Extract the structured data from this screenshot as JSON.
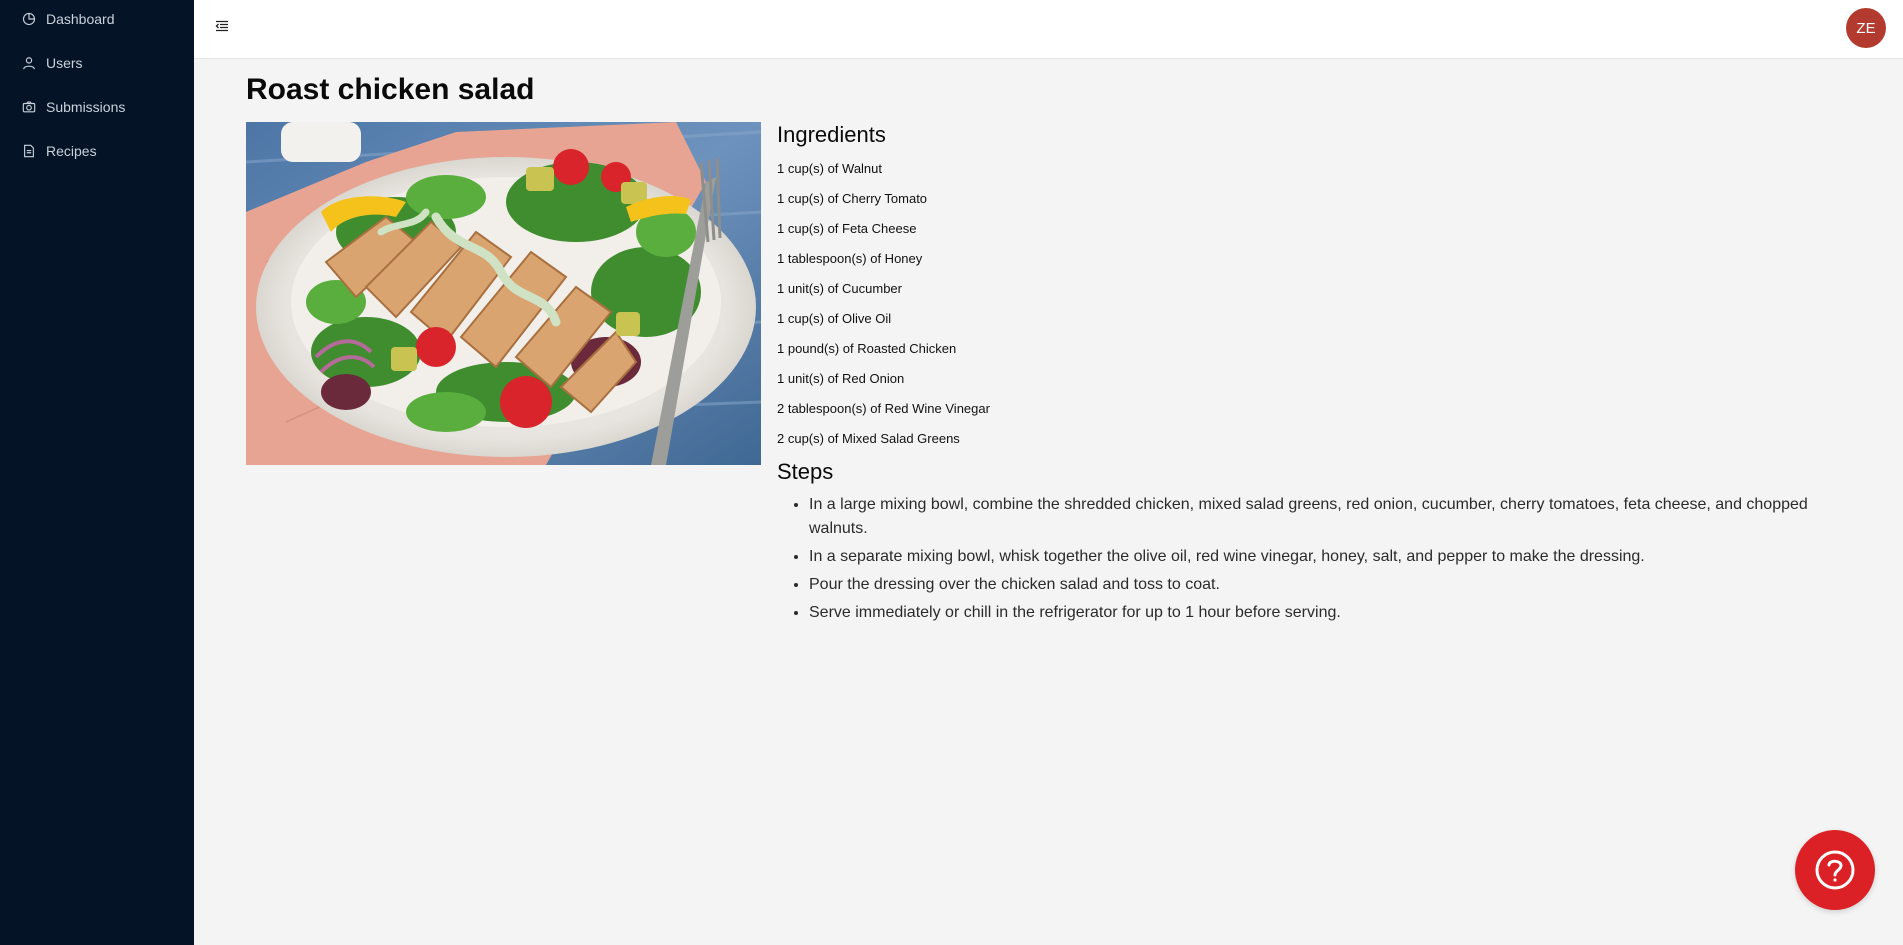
{
  "sidebar": {
    "items": [
      {
        "label": "Dashboard",
        "icon": "pie-chart-icon"
      },
      {
        "label": "Users",
        "icon": "user-icon"
      },
      {
        "label": "Submissions",
        "icon": "camera-icon"
      },
      {
        "label": "Recipes",
        "icon": "document-icon"
      }
    ]
  },
  "header": {
    "avatar_initials": "ZE"
  },
  "recipe": {
    "title": "Roast chicken salad",
    "ingredients_heading": "Ingredients",
    "ingredients": [
      "1 cup(s) of Walnut",
      "1 cup(s) of Cherry Tomato",
      "1 cup(s) of Feta Cheese",
      "1 tablespoon(s) of Honey",
      "1 unit(s) of Cucumber",
      "1 cup(s) of Olive Oil",
      "1 pound(s) of Roasted Chicken",
      "1 unit(s) of Red Onion",
      "2 tablespoon(s) of Red Wine Vinegar",
      "2 cup(s) of Mixed Salad Greens"
    ],
    "steps_heading": "Steps",
    "steps": [
      "In a large mixing bowl, combine the shredded chicken, mixed salad greens, red onion, cucumber, cherry tomatoes, feta cheese, and chopped walnuts.",
      "In a separate mixing bowl, whisk together the olive oil, red wine vinegar, honey, salt, and pepper to make the dressing.",
      "Pour the dressing over the chicken salad and toss to coat.",
      "Serve immediately or chill in the refrigerator for up to 1 hour before serving."
    ]
  },
  "colors": {
    "sidebar_bg": "#041426",
    "avatar_bg": "#b23a2e",
    "help_button_bg": "#dc2126",
    "page_bg": "#f4f4f4"
  }
}
